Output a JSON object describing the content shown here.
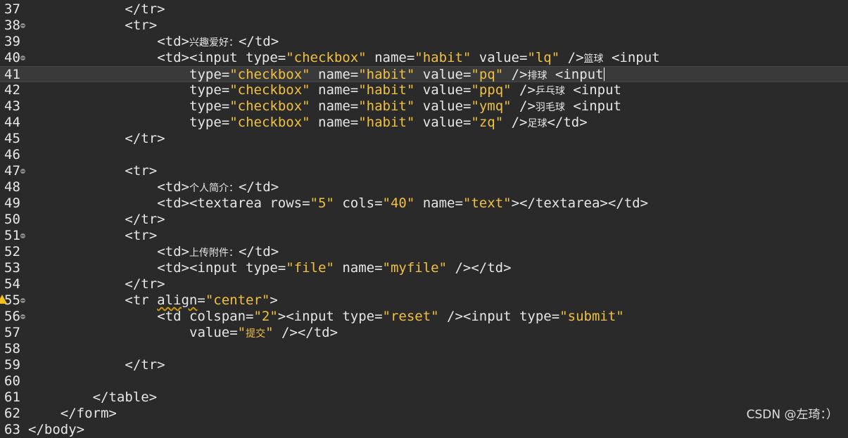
{
  "editor": {
    "lines": [
      {
        "num": "37",
        "indent": 12,
        "fold": false,
        "tokens": [
          [
            "tag",
            "</tr>"
          ]
        ]
      },
      {
        "num": "38",
        "indent": 12,
        "fold": true,
        "tokens": [
          [
            "tag",
            "<tr>"
          ]
        ]
      },
      {
        "num": "39",
        "indent": 16,
        "fold": false,
        "tokens": [
          [
            "tag",
            "<td>"
          ],
          [
            "zh",
            "兴趣爱好："
          ],
          [
            "tag",
            "</td>"
          ]
        ]
      },
      {
        "num": "40",
        "indent": 16,
        "fold": true,
        "tokens": [
          [
            "tag",
            "<td><input "
          ],
          [
            "attr",
            "type="
          ],
          [
            "str",
            "\"checkbox\""
          ],
          [
            "attr",
            " name="
          ],
          [
            "str",
            "\"habit\""
          ],
          [
            "attr",
            " value="
          ],
          [
            "str",
            "\"lq\""
          ],
          [
            "tag",
            " />"
          ],
          [
            "zh",
            "篮球"
          ],
          [
            "tag",
            " <input"
          ]
        ]
      },
      {
        "num": "41",
        "indent": 20,
        "fold": false,
        "current": true,
        "caret": true,
        "tokens": [
          [
            "attr",
            "type="
          ],
          [
            "str",
            "\"checkbox\""
          ],
          [
            "attr",
            " name="
          ],
          [
            "str",
            "\"habit\""
          ],
          [
            "attr",
            " value="
          ],
          [
            "str",
            "\"pq\""
          ],
          [
            "tag",
            " />"
          ],
          [
            "zh",
            "排球"
          ],
          [
            "tag",
            " <input"
          ]
        ]
      },
      {
        "num": "42",
        "indent": 20,
        "fold": false,
        "tokens": [
          [
            "attr",
            "type="
          ],
          [
            "str",
            "\"checkbox\""
          ],
          [
            "attr",
            " name="
          ],
          [
            "str",
            "\"habit\""
          ],
          [
            "attr",
            " value="
          ],
          [
            "str",
            "\"ppq\""
          ],
          [
            "tag",
            " />"
          ],
          [
            "zh",
            "乒乓球"
          ],
          [
            "tag",
            " <input"
          ]
        ]
      },
      {
        "num": "43",
        "indent": 20,
        "fold": false,
        "tokens": [
          [
            "attr",
            "type="
          ],
          [
            "str",
            "\"checkbox\""
          ],
          [
            "attr",
            " name="
          ],
          [
            "str",
            "\"habit\""
          ],
          [
            "attr",
            " value="
          ],
          [
            "str",
            "\"ymq\""
          ],
          [
            "tag",
            " />"
          ],
          [
            "zh",
            "羽毛球"
          ],
          [
            "tag",
            " <input"
          ]
        ]
      },
      {
        "num": "44",
        "indent": 20,
        "fold": false,
        "tokens": [
          [
            "attr",
            "type="
          ],
          [
            "str",
            "\"checkbox\""
          ],
          [
            "attr",
            " name="
          ],
          [
            "str",
            "\"habit\""
          ],
          [
            "attr",
            " value="
          ],
          [
            "str",
            "\"zq\""
          ],
          [
            "tag",
            " />"
          ],
          [
            "zh",
            "足球"
          ],
          [
            "tag",
            "</td>"
          ]
        ]
      },
      {
        "num": "45",
        "indent": 12,
        "fold": false,
        "tokens": [
          [
            "tag",
            "</tr>"
          ]
        ]
      },
      {
        "num": "46",
        "indent": 0,
        "fold": false,
        "tokens": []
      },
      {
        "num": "47",
        "indent": 12,
        "fold": true,
        "tokens": [
          [
            "tag",
            "<tr>"
          ]
        ]
      },
      {
        "num": "48",
        "indent": 16,
        "fold": false,
        "tokens": [
          [
            "tag",
            "<td>"
          ],
          [
            "zh",
            "个人简介："
          ],
          [
            "tag",
            "</td>"
          ]
        ]
      },
      {
        "num": "49",
        "indent": 16,
        "fold": false,
        "tokens": [
          [
            "tag",
            "<td><textarea "
          ],
          [
            "attr",
            "rows="
          ],
          [
            "str",
            "\"5\""
          ],
          [
            "attr",
            " cols="
          ],
          [
            "str",
            "\"40\""
          ],
          [
            "attr",
            " name="
          ],
          [
            "str",
            "\"text\""
          ],
          [
            "tag",
            "></textarea></td>"
          ]
        ]
      },
      {
        "num": "50",
        "indent": 12,
        "fold": false,
        "tokens": [
          [
            "tag",
            "</tr>"
          ]
        ]
      },
      {
        "num": "51",
        "indent": 12,
        "fold": true,
        "tokens": [
          [
            "tag",
            "<tr>"
          ]
        ]
      },
      {
        "num": "52",
        "indent": 16,
        "fold": false,
        "tokens": [
          [
            "tag",
            "<td>"
          ],
          [
            "zh",
            "上传附件："
          ],
          [
            "tag",
            "</td>"
          ]
        ]
      },
      {
        "num": "53",
        "indent": 16,
        "fold": false,
        "tokens": [
          [
            "tag",
            "<td><input "
          ],
          [
            "attr",
            "type="
          ],
          [
            "str",
            "\"file\""
          ],
          [
            "attr",
            " name="
          ],
          [
            "str",
            "\"myfile\""
          ],
          [
            "tag",
            " /></td>"
          ]
        ]
      },
      {
        "num": "54",
        "indent": 12,
        "fold": false,
        "tokens": [
          [
            "tag",
            "</tr>"
          ]
        ]
      },
      {
        "num": "55",
        "indent": 12,
        "fold": true,
        "warning": true,
        "tokens": [
          [
            "tag",
            "<tr "
          ],
          [
            "squig",
            "align"
          ],
          [
            "attr",
            "="
          ],
          [
            "str",
            "\"center\""
          ],
          [
            "tag",
            ">"
          ]
        ]
      },
      {
        "num": "56",
        "indent": 16,
        "fold": true,
        "tokens": [
          [
            "tag",
            "<td "
          ],
          [
            "attr",
            "colspan="
          ],
          [
            "str",
            "\"2\""
          ],
          [
            "tag",
            "><input "
          ],
          [
            "attr",
            "type="
          ],
          [
            "str",
            "\"reset\""
          ],
          [
            "tag",
            " /><input "
          ],
          [
            "attr",
            "type="
          ],
          [
            "str",
            "\"submit\""
          ]
        ]
      },
      {
        "num": "57",
        "indent": 20,
        "fold": false,
        "tokens": [
          [
            "attr",
            "value="
          ],
          [
            "str",
            "\""
          ],
          [
            "strzh",
            "提交"
          ],
          [
            "str",
            "\""
          ],
          [
            "tag",
            " /></td>"
          ]
        ]
      },
      {
        "num": "58",
        "indent": 0,
        "fold": false,
        "tokens": []
      },
      {
        "num": "59",
        "indent": 12,
        "fold": false,
        "tokens": [
          [
            "tag",
            "</tr>"
          ]
        ]
      },
      {
        "num": "60",
        "indent": 0,
        "fold": false,
        "tokens": []
      },
      {
        "num": "61",
        "indent": 8,
        "fold": false,
        "tokens": [
          [
            "tag",
            "</table>"
          ]
        ]
      },
      {
        "num": "62",
        "indent": 4,
        "fold": false,
        "tokens": [
          [
            "tag",
            "</form>"
          ]
        ]
      },
      {
        "num": "63",
        "indent": 0,
        "fold": false,
        "tokens": [
          [
            "tag",
            "</body>"
          ]
        ]
      }
    ]
  },
  "watermark": "CSDN @左琦：）",
  "colors": {
    "background": "#2a2a2a",
    "string": "#f0c040",
    "text": "#e6e6e6",
    "current_line": "#3a3a3a"
  }
}
